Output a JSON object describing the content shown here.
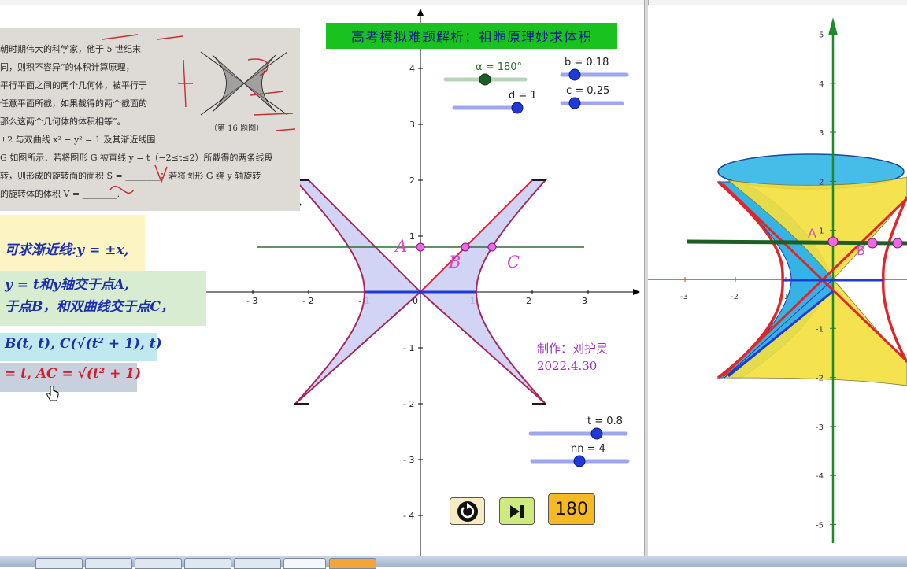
{
  "banner": {
    "title": "高考模拟难题解析：祖暅原理妙求体积"
  },
  "sliders": {
    "alpha": "α = 180°",
    "b": "b = 0.18",
    "c": "c = 0.25",
    "d": "d = 1",
    "t": "t = 0.8",
    "nn": "nn = 4"
  },
  "buttons": {
    "reset_icon": "reset-icon",
    "play_icon": "step-forward-icon",
    "value_label": "180"
  },
  "credit": {
    "author": "制作：刘护灵",
    "date": "2022.4.30"
  },
  "graph2d": {
    "x_ticks": [
      "- 3",
      "- 2",
      "- 1",
      "0",
      "1",
      "2",
      "3"
    ],
    "y_ticks": [
      "4",
      "3",
      "2",
      "1",
      "- 1",
      "- 2",
      "- 3",
      "- 4"
    ],
    "point_labels": [
      "A",
      "B",
      "C"
    ],
    "t": 0.8
  },
  "graph3d": {
    "x_ticks": [
      "-3",
      "-2",
      "-1"
    ],
    "y_ticks": [
      "5",
      "4",
      "3",
      "2",
      "1",
      "-1",
      "-2",
      "-3",
      "-4",
      "-5"
    ],
    "point_labels": [
      "A",
      "B"
    ]
  },
  "notes": {
    "asymptote": "可求渐近线:y = ±x,",
    "intersect1": "y = t和y轴交于点A,",
    "intersect2": "于点B，和双曲线交于点C，",
    "coords": "B(t, t), C(√(t² + 1), t)",
    "lengths": "= t, AC = √(t² + 1)"
  },
  "photo": {
    "lines": [
      "朝时期伟大的科学家，他于 5 世纪末",
      "同，则积不容异”的体积计算原理，",
      "平行平面之间的两个几何体，被平行于",
      "任意平面所截，如果截得的两个截面的",
      "那么这两个几何体的体积相等”。",
      "±2 与双曲线 x² − y² = 1 及其渐近线围",
      "G 如图所示．若将图形 G 被直线 y = t（−2≤t≤2）所截得的两条线段",
      "转，则形成的旋转面的面积 S = ________；若将图形 G 绕 y 轴旋转",
      "的旋转体的体积 V = ________."
    ],
    "caption": "（第 16 题图）"
  }
}
